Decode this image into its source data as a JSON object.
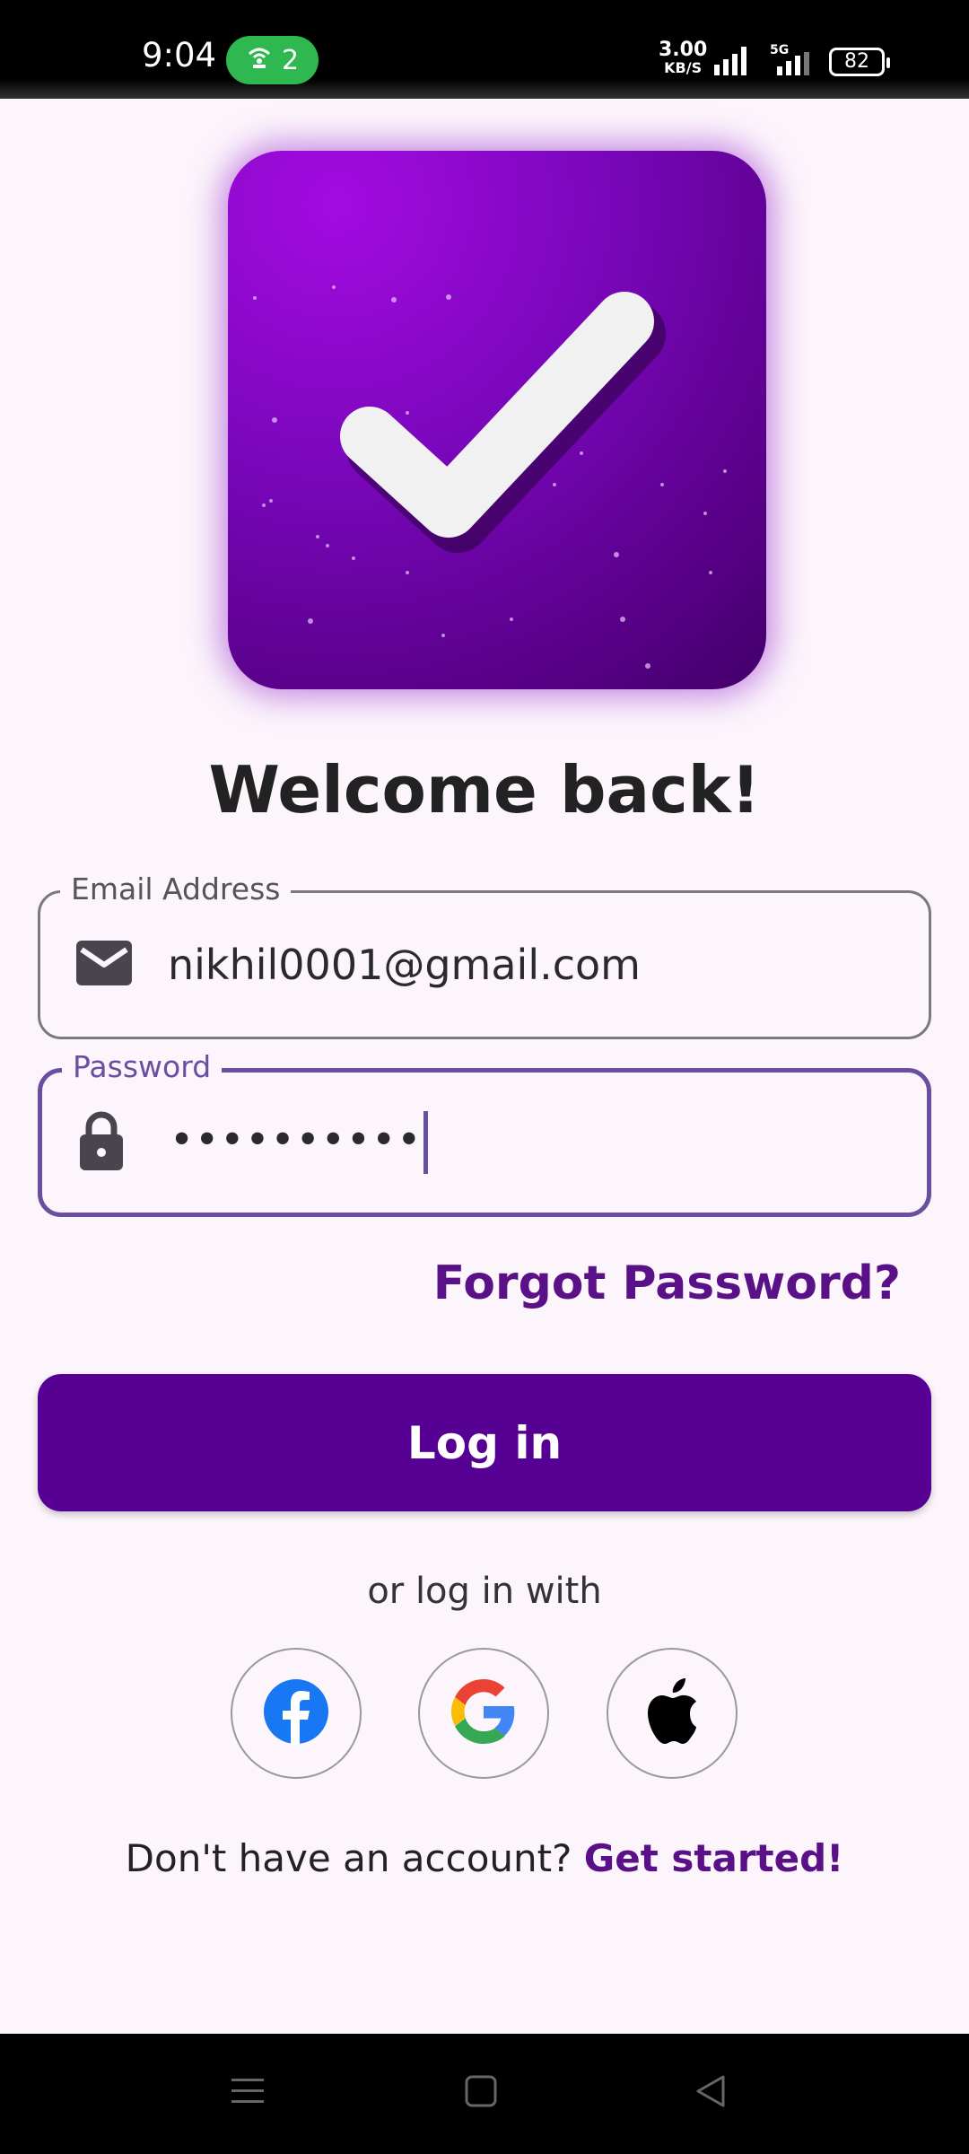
{
  "status_bar": {
    "time": "9:04",
    "hotspot_count": "2",
    "net_speed": "3.00",
    "net_unit": "KB/S",
    "network_type": "5G",
    "battery": "82"
  },
  "welcome_title": "Welcome back!",
  "email_field": {
    "label": "Email Address",
    "value": "nikhil0001@gmail.com",
    "icon": "mail-icon"
  },
  "password_field": {
    "label": "Password",
    "value": "••••••••••",
    "icon": "lock-icon"
  },
  "forgot_password": "Forgot Password?",
  "login_button": "Log in",
  "or_text": "or log in with",
  "social": [
    "facebook-icon",
    "google-icon",
    "apple-icon"
  ],
  "signup": {
    "prompt": "Don't have an account?",
    "cta": "Get started!"
  },
  "colors": {
    "primary": "#560094",
    "link": "#5a1187",
    "background": "#fcf5fc",
    "focus_border": "#6b4ea0"
  }
}
